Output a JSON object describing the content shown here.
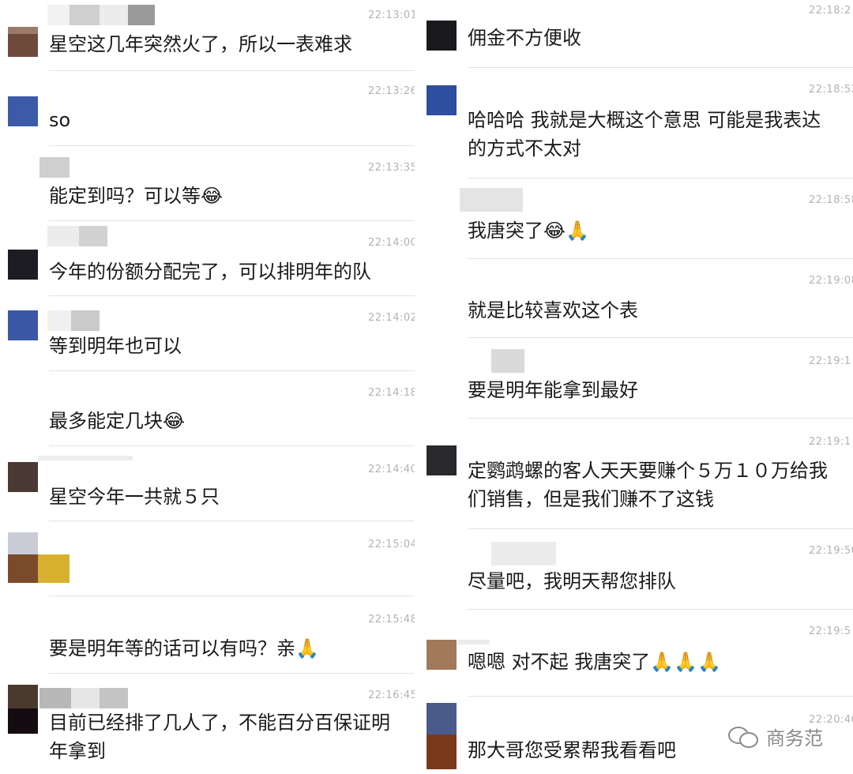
{
  "chat": {
    "left": [
      {
        "time": "22:13:01",
        "text": "星空这几年突然火了，所以一表难求"
      },
      {
        "time": "22:13:26",
        "text": "so"
      },
      {
        "time": "22:13:35",
        "text": "能定到吗？可以等😂"
      },
      {
        "time": "22:14:00",
        "text": "今年的份额分配完了，可以排明年的队"
      },
      {
        "time": "22:14:02",
        "text": "等到明年也可以"
      },
      {
        "time": "22:14:18",
        "text": "最多能定几块😂"
      },
      {
        "time": "22:14:40",
        "text": "星空今年一共就５只"
      },
      {
        "time": "22:15:04",
        "text": ""
      },
      {
        "time": "22:15:48",
        "text": "要是明年等的话可以有吗？亲🙏"
      },
      {
        "time": "22:16:45",
        "text": "目前已经排了几人了，不能百分百保证明\n年拿到"
      }
    ],
    "right": [
      {
        "time": "22:18:2",
        "text": "佣金不方便收"
      },
      {
        "time": "22:18:52",
        "text": "哈哈哈 我就是大概这个意思 可能是我表达\n的方式不太对"
      },
      {
        "time": "22:18:58",
        "text": "我唐突了😂🙏"
      },
      {
        "time": "22:19:08",
        "text": "就是比较喜欢这个表"
      },
      {
        "time": "22:19:1",
        "text": "要是明年能拿到最好"
      },
      {
        "time": "22:19:1",
        "text": "定鹦鹉螺的客人天天要赚个５万１０万给我\n们销售，但是我们赚不了这钱"
      },
      {
        "time": "22:19:50",
        "text": "尽量吧，我明天帮您排队"
      },
      {
        "time": "22:19:5",
        "text": "嗯嗯 对不起 我唐突了🙏🙏🙏"
      },
      {
        "time": "22:20:40",
        "text": "那大哥您受累帮我看看吧"
      }
    ]
  },
  "watermark": {
    "icon": "wechat-icon",
    "text": "商务范"
  },
  "colors": {
    "separator": "#e3e3e3",
    "timestamp": "#b3b3b3",
    "text": "#1a1a1a"
  }
}
